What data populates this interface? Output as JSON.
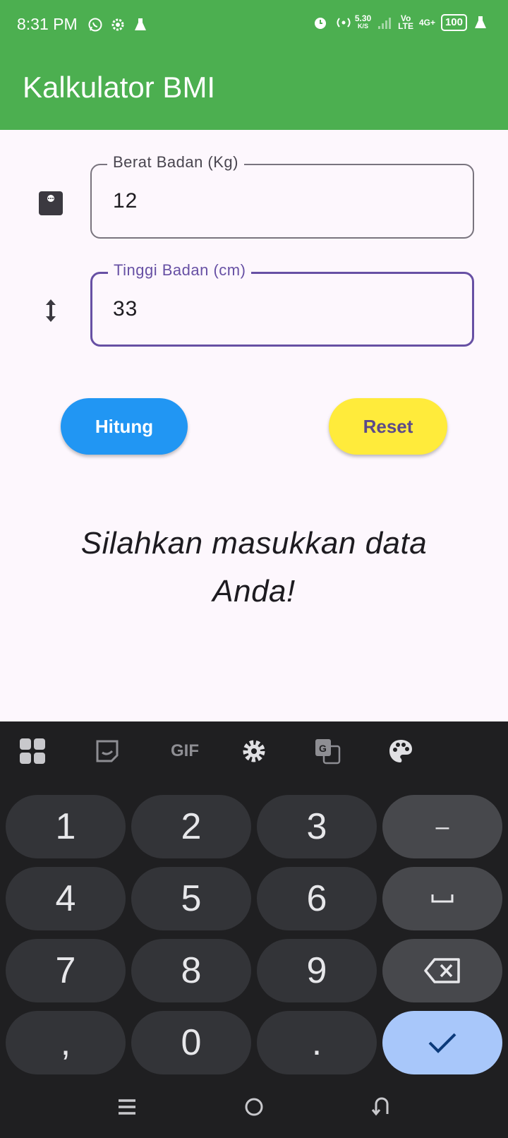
{
  "status_bar": {
    "time": "8:31 PM",
    "net_speed_value": "5.30",
    "net_speed_unit": "K/S",
    "volte_top": "Vo",
    "volte_bottom": "LTE",
    "network": "4G+",
    "battery": "100",
    "icons_left": [
      "whatsapp-icon",
      "settings-icon",
      "flask-icon"
    ],
    "icons_right": [
      "alarm-icon",
      "hotspot-icon",
      "signal-icon",
      "charging-icon"
    ]
  },
  "app_bar": {
    "title": "Kalkulator BMI",
    "color": "#4caf50"
  },
  "form": {
    "weight": {
      "label": "Berat Badan (Kg)",
      "value": "12",
      "icon": "scale-icon"
    },
    "height": {
      "label": "Tinggi Badan (cm)",
      "value": "33",
      "icon": "height-arrows-icon",
      "focused": true
    }
  },
  "buttons": {
    "calculate": {
      "label": "Hitung",
      "color": "#2196f3"
    },
    "reset": {
      "label": "Reset",
      "color": "#ffeb3b"
    }
  },
  "result_message": "Silahkan masukkan data Anda!",
  "keyboard": {
    "toolbar": [
      "apps-icon",
      "sticker-icon",
      "gif-icon",
      "settings-icon",
      "translate-icon",
      "palette-icon"
    ],
    "gif_label": "GIF",
    "keys": [
      [
        "1",
        "2",
        "3",
        "–"
      ],
      [
        "4",
        "5",
        "6",
        "␣"
      ],
      [
        "7",
        "8",
        "9",
        "backspace"
      ],
      [
        ",",
        "0",
        ".",
        "enter"
      ]
    ]
  },
  "nav_bar": [
    "recents-icon",
    "home-icon",
    "back-icon"
  ]
}
